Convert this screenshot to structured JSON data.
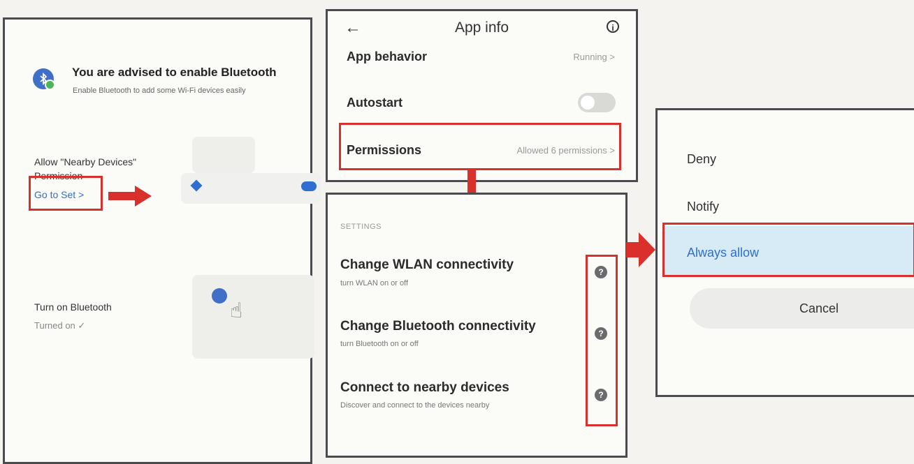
{
  "screen1": {
    "bt_title": "You are advised to enable Bluetooth",
    "bt_subtitle": "Enable Bluetooth to add some Wi-Fi devices easily",
    "nearby_label": "Allow \"Nearby Devices\" Permission",
    "goto_label": "Go to Set >",
    "turn_on_label": "Turn on Bluetooth",
    "turned_on_status": "Turned on ✓"
  },
  "screen2": {
    "title": "App info",
    "back_icon": "←",
    "info_icon": "i",
    "rows": [
      {
        "label": "App behavior",
        "value": "Running >"
      },
      {
        "label": "Autostart",
        "value": ""
      },
      {
        "label": "Permissions",
        "value": "Allowed 6 permissions >"
      }
    ],
    "autostart_on": false
  },
  "screen3": {
    "section_header": "SETTINGS",
    "items": [
      {
        "title": "Change WLAN connectivity",
        "subtitle": "turn WLAN on or off"
      },
      {
        "title": "Change Bluetooth connectivity",
        "subtitle": "turn Bluetooth on or off"
      },
      {
        "title": "Connect to nearby devices",
        "subtitle": "Discover and connect to the devices nearby"
      }
    ],
    "help_icon": "?"
  },
  "screen4": {
    "options": [
      "Deny",
      "Notify",
      "Always allow"
    ],
    "selected": "Always allow",
    "cancel_label": "Cancel"
  },
  "colors": {
    "highlight_red": "#d9302b",
    "link_blue": "#2f6fd0",
    "selected_bg": "#d7ebf6"
  }
}
